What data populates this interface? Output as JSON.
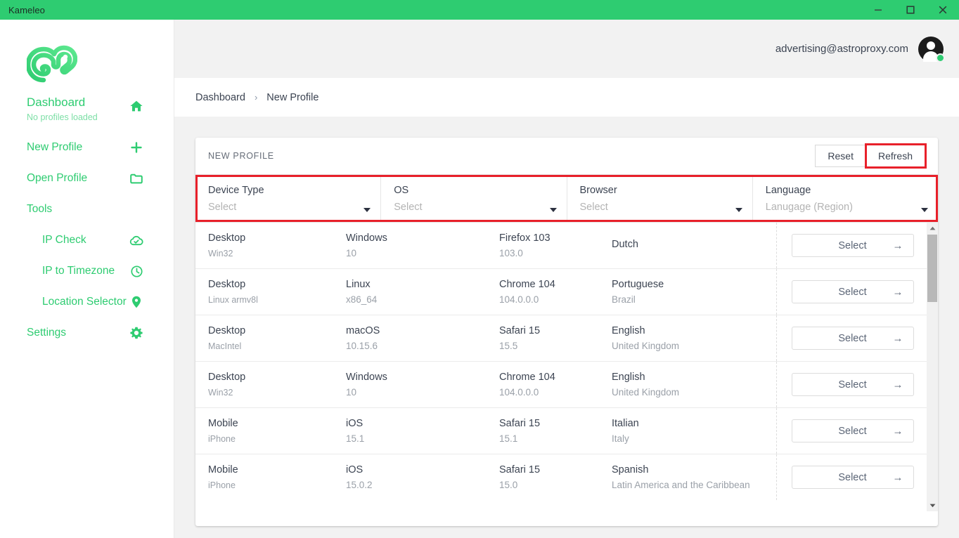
{
  "window": {
    "title": "Kameleo",
    "accent_color": "#2ecc71",
    "controls": [
      {
        "name": "minimize",
        "glyph": "minimize-icon"
      },
      {
        "name": "maximize",
        "glyph": "maximize-icon"
      },
      {
        "name": "close",
        "glyph": "close-icon"
      }
    ]
  },
  "sidebar": {
    "logo": "kameleo-chameleon-logo",
    "items": [
      {
        "label": "Dashboard",
        "sublabel": "No profiles loaded",
        "icon": "home-icon",
        "type": "dashboard"
      },
      {
        "label": "New Profile",
        "icon": "plus-icon",
        "type": "item"
      },
      {
        "label": "Open Profile",
        "icon": "folder-icon",
        "type": "item"
      },
      {
        "label": "Tools",
        "icon": "",
        "type": "group"
      },
      {
        "label": "IP Check",
        "icon": "cloud-check-icon",
        "type": "sub"
      },
      {
        "label": "IP to Timezone",
        "icon": "clock-icon",
        "type": "sub"
      },
      {
        "label": "Location Selector",
        "icon": "map-pin-icon",
        "type": "sub"
      },
      {
        "label": "Settings",
        "icon": "gear-icon",
        "type": "item"
      }
    ]
  },
  "topbar": {
    "user_email": "advertising@astroproxy.com",
    "avatar": "user-avatar",
    "status": "online"
  },
  "breadcrumb": {
    "root": "Dashboard",
    "separator": "›",
    "current": "New Profile"
  },
  "card": {
    "title": "NEW PROFILE",
    "reset_label": "Reset",
    "refresh_label": "Refresh",
    "highlight_color": "#e8202a"
  },
  "filters": [
    {
      "label": "Device Type",
      "value": "Select",
      "icon": "chevron-down-icon"
    },
    {
      "label": "OS",
      "value": "Select",
      "icon": "chevron-down-icon"
    },
    {
      "label": "Browser",
      "value": "Select",
      "icon": "chevron-down-icon"
    },
    {
      "label": "Language",
      "value": "Lanugage (Region)",
      "icon": "chevron-down-icon"
    }
  ],
  "table": {
    "select_label": "Select",
    "select_arrow": "→",
    "rows": [
      {
        "device": "Desktop",
        "device_sub": "Win32",
        "os": "Windows",
        "os_sub": "10",
        "browser": "Firefox 103",
        "browser_sub": "103.0",
        "language": "Dutch",
        "language_sub": ""
      },
      {
        "device": "Desktop",
        "device_sub": "Linux armv8l",
        "os": "Linux",
        "os_sub": "x86_64",
        "browser": "Chrome 104",
        "browser_sub": "104.0.0.0",
        "language": "Portuguese",
        "language_sub": "Brazil"
      },
      {
        "device": "Desktop",
        "device_sub": "MacIntel",
        "os": "macOS",
        "os_sub": "10.15.6",
        "browser": "Safari 15",
        "browser_sub": "15.5",
        "language": "English",
        "language_sub": "United Kingdom"
      },
      {
        "device": "Desktop",
        "device_sub": "Win32",
        "os": "Windows",
        "os_sub": "10",
        "browser": "Chrome 104",
        "browser_sub": "104.0.0.0",
        "language": "English",
        "language_sub": "United Kingdom"
      },
      {
        "device": "Mobile",
        "device_sub": "iPhone",
        "os": "iOS",
        "os_sub": "15.1",
        "browser": "Safari 15",
        "browser_sub": "15.1",
        "language": "Italian",
        "language_sub": "Italy"
      },
      {
        "device": "Mobile",
        "device_sub": "iPhone",
        "os": "iOS",
        "os_sub": "15.0.2",
        "browser": "Safari 15",
        "browser_sub": "15.0",
        "language": "Spanish",
        "language_sub": "Latin America and the Caribbean"
      }
    ]
  },
  "scrollbar": {
    "up_icon": "scroll-up-arrow-icon",
    "down_icon": "scroll-down-arrow-icon",
    "thumb": "scrollbar-thumb"
  }
}
